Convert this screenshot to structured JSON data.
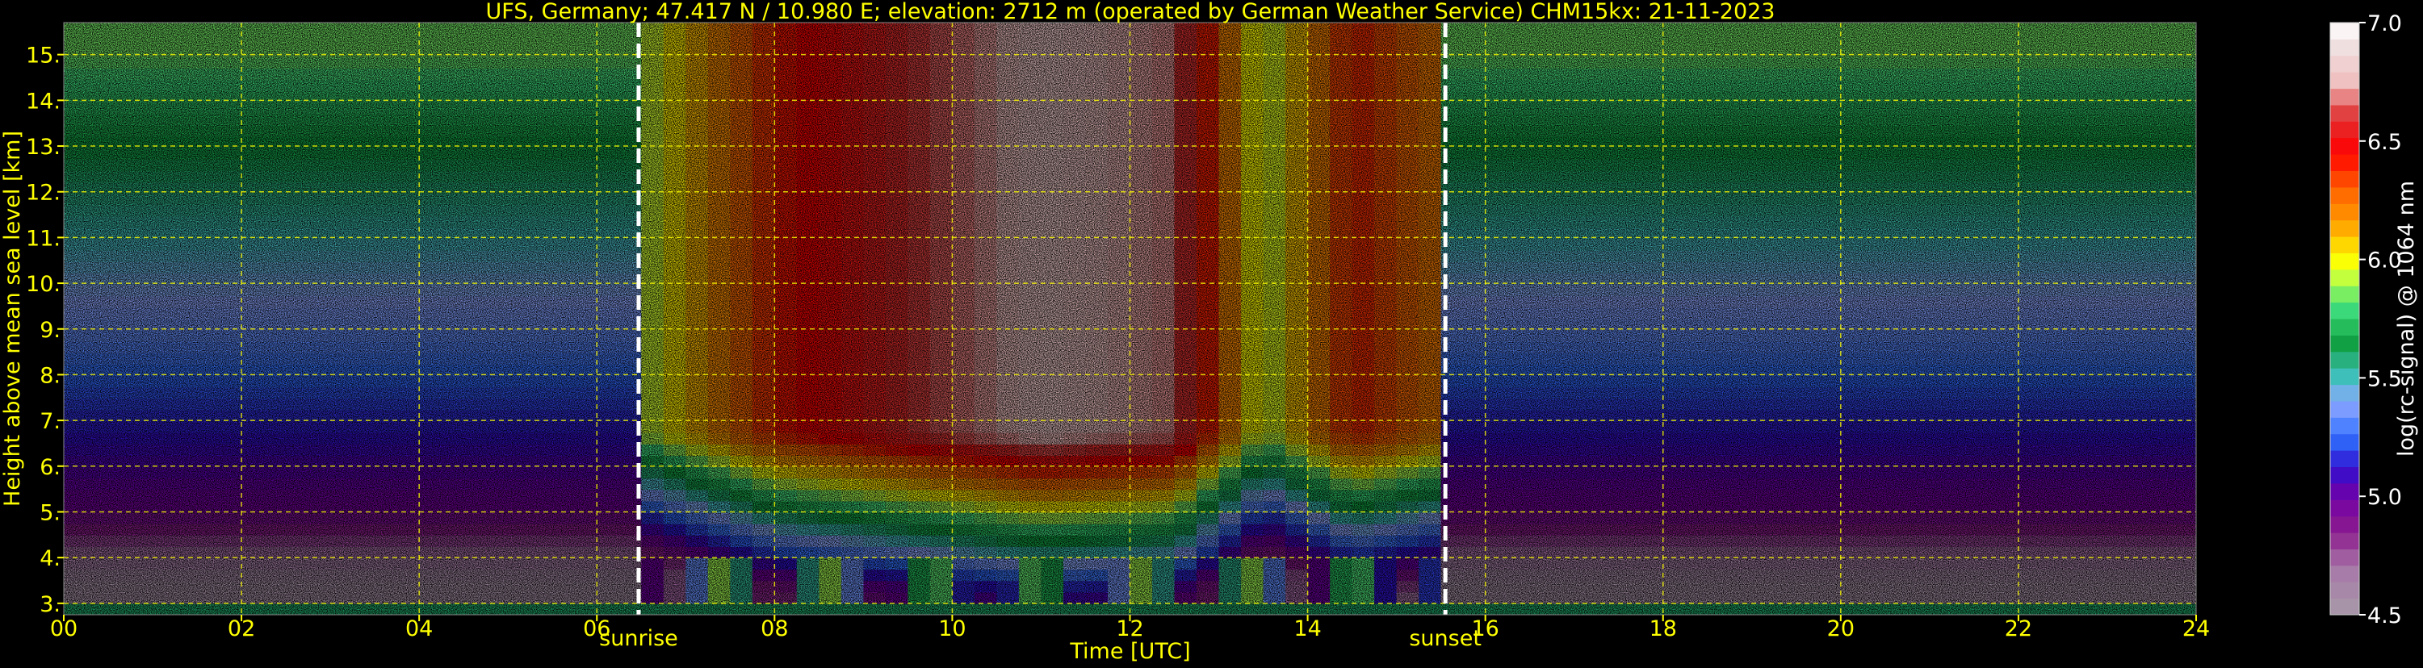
{
  "chart_data": {
    "type": "heatmap",
    "title": "UFS, Germany; 47.417 N / 10.980 E; elevation: 2712 m  (operated by German Weather Service)    CHM15kx: 21-11-2023",
    "xlabel": "Time [UTC]",
    "ylabel": "Height above mean sea level [km]",
    "colorbar_label": "log(rc-signal) @ 1064 nm",
    "xlim": [
      0,
      24
    ],
    "ylim": [
      2.75,
      15.7
    ],
    "clim": [
      4.5,
      7.0
    ],
    "x_ticks": [
      "00",
      "02",
      "04",
      "06",
      "08",
      "10",
      "12",
      "14",
      "16",
      "18",
      "20",
      "22",
      "24"
    ],
    "y_ticks": [
      "3.",
      "4.",
      "5.",
      "6.",
      "7.",
      "8.",
      "9.",
      "10.",
      "11.",
      "12.",
      "13.",
      "14.",
      "15."
    ],
    "colorbar_ticks": [
      "4.5",
      "5.0",
      "5.5",
      "6.0",
      "6.5",
      "7.0"
    ],
    "grid": true,
    "markers": [
      {
        "label": "sunrise",
        "time": 6.47
      },
      {
        "label": "sunset",
        "time": 15.55
      }
    ],
    "description_points": {
      "night_background_by_height": [
        {
          "height": 3.5,
          "value": 4.55
        },
        {
          "height": 5.0,
          "value": 4.95
        },
        {
          "height": 7.0,
          "value": 5.15
        },
        {
          "height": 9.0,
          "value": 5.35
        },
        {
          "height": 11.0,
          "value": 5.5
        },
        {
          "height": 13.0,
          "value": 5.65
        },
        {
          "height": 15.0,
          "value": 5.85
        }
      ],
      "day_background_by_time": [
        {
          "time": 6.5,
          "value": 5.9
        },
        {
          "time": 8.0,
          "value": 6.4
        },
        {
          "time": 11.0,
          "value": 6.8
        },
        {
          "time": 12.5,
          "value": 6.7
        },
        {
          "time": 13.5,
          "value": 5.9
        },
        {
          "time": 14.5,
          "value": 6.4
        },
        {
          "time": 15.5,
          "value": 6.2
        }
      ],
      "boundary_layer_top_km": 4.0
    }
  },
  "colors": {
    "axis_text": "#ffff00",
    "colorbar_text": "#ffffff",
    "grid": "#ffff00",
    "marker_line": "#ffffff",
    "background": "#000000"
  }
}
